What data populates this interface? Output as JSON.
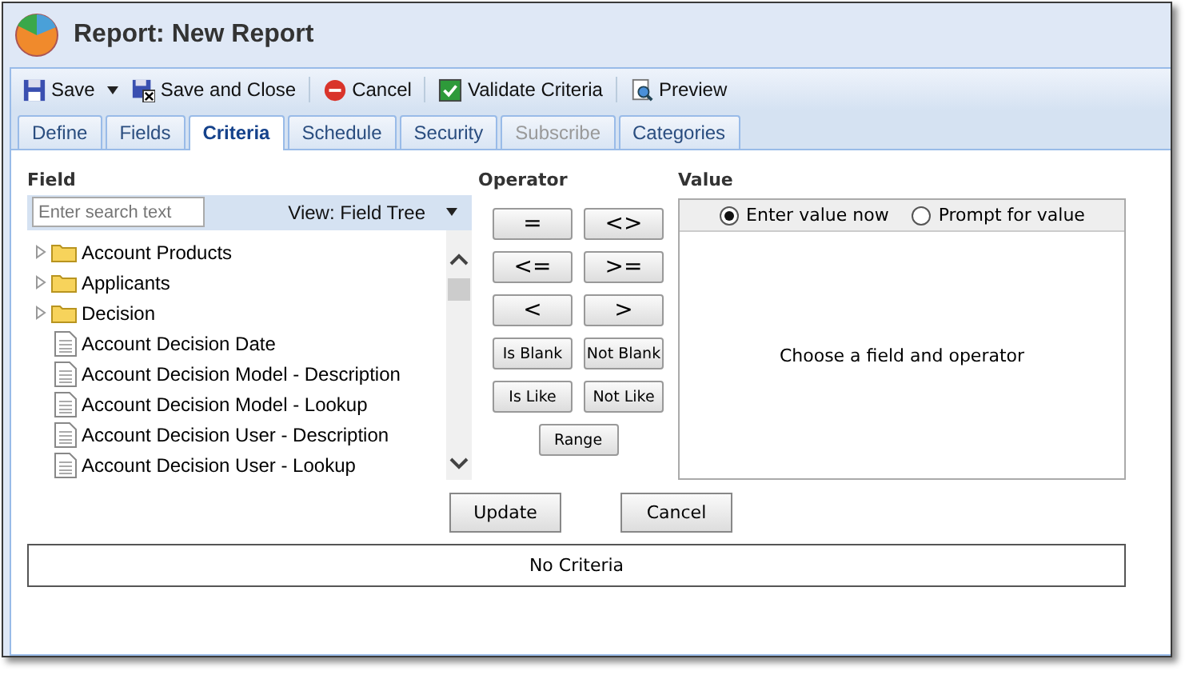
{
  "window": {
    "title": "Report: New Report"
  },
  "toolbar": [
    {
      "label": "Save",
      "kind": "save",
      "dropdown": true
    },
    {
      "label": "Save and Close",
      "kind": "save-close",
      "dropdown": false
    },
    {
      "label": "Cancel",
      "kind": "cancel",
      "dropdown": false
    },
    {
      "label": "Validate Criteria",
      "kind": "validate",
      "dropdown": false
    },
    {
      "label": "Preview",
      "kind": "preview",
      "dropdown": false
    }
  ],
  "tabs": [
    {
      "label": "Define",
      "selected": false,
      "disabled": false
    },
    {
      "label": "Fields",
      "selected": false,
      "disabled": false
    },
    {
      "label": "Criteria",
      "selected": true,
      "disabled": false
    },
    {
      "label": "Schedule",
      "selected": false,
      "disabled": false
    },
    {
      "label": "Security",
      "selected": false,
      "disabled": false
    },
    {
      "label": "Subscribe",
      "selected": false,
      "disabled": true
    },
    {
      "label": "Categories",
      "selected": false,
      "disabled": false
    }
  ],
  "field": {
    "heading": "Field",
    "search": {
      "placeholder": "Enter search text"
    },
    "view": "View: Field Tree",
    "items": [
      {
        "label": "Account Products",
        "kind": "folder"
      },
      {
        "label": "Applicants",
        "kind": "folder"
      },
      {
        "label": "Decision",
        "kind": "folder"
      },
      {
        "label": "Account Decision Date",
        "kind": "field"
      },
      {
        "label": "Account Decision Model - Description",
        "kind": "field"
      },
      {
        "label": "Account Decision Model - Lookup",
        "kind": "field"
      },
      {
        "label": "Account Decision User - Description",
        "kind": "field"
      },
      {
        "label": "Account Decision User - Lookup",
        "kind": "field"
      }
    ]
  },
  "operator": {
    "heading": "Operator",
    "rows": [
      [
        "=",
        "<>"
      ],
      [
        "<=",
        ">="
      ],
      [
        "<",
        ">"
      ],
      [
        "Is Blank",
        "Not Blank"
      ],
      [
        "Is Like",
        "Not Like"
      ],
      [
        "Range"
      ]
    ]
  },
  "value": {
    "heading": "Value",
    "options": [
      {
        "label": "Enter value now",
        "selected": true
      },
      {
        "label": "Prompt for value",
        "selected": false
      }
    ],
    "message": "Choose a field and operator"
  },
  "buttons": [
    "Update",
    "Cancel"
  ],
  "criteria": "No Criteria"
}
